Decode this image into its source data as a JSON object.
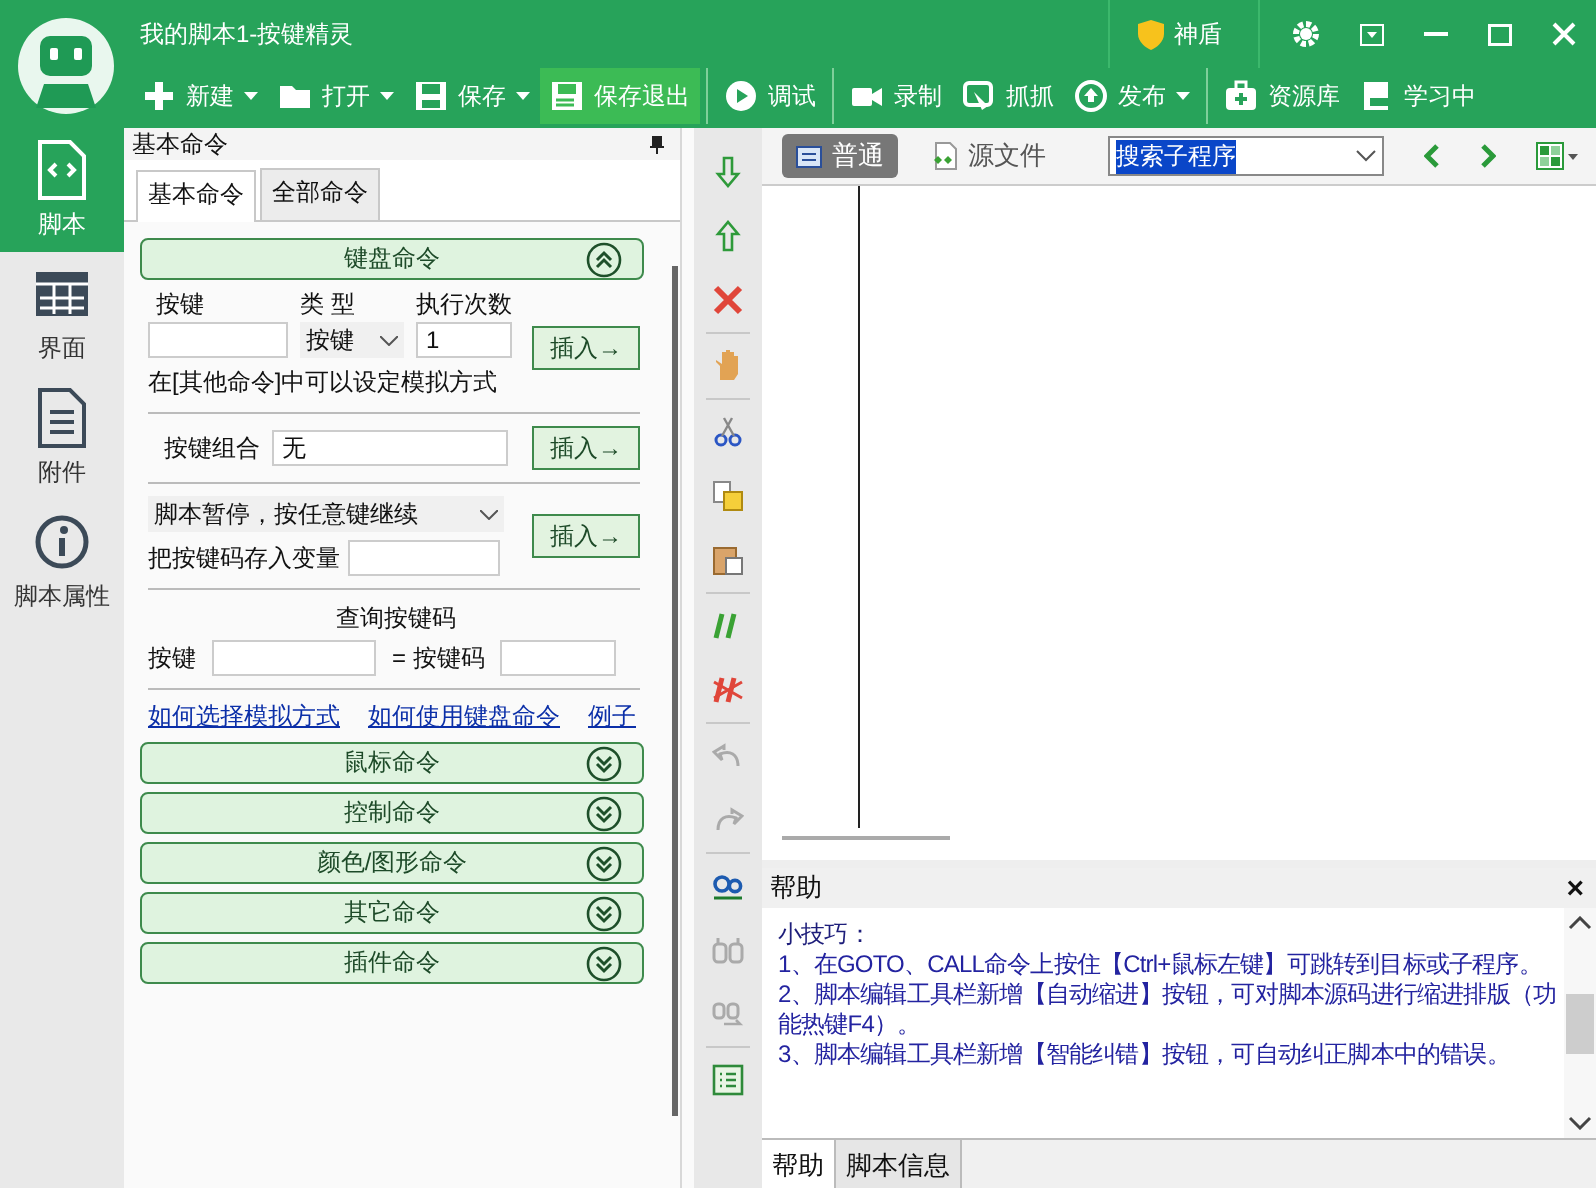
{
  "window": {
    "title": "我的脚本1-按键精灵"
  },
  "title_bar": {
    "shield": "神盾"
  },
  "toolbar": [
    {
      "label": "新建",
      "dropdown": true,
      "highlighted": false,
      "separator_before": false
    },
    {
      "label": "打开",
      "dropdown": true,
      "highlighted": false,
      "separator_before": false
    },
    {
      "label": "保存",
      "dropdown": true,
      "highlighted": false,
      "separator_before": false
    },
    {
      "label": "保存退出",
      "dropdown": false,
      "highlighted": true,
      "separator_before": false
    },
    {
      "label": "调试",
      "dropdown": false,
      "highlighted": false,
      "separator_before": true
    },
    {
      "label": "录制",
      "dropdown": false,
      "highlighted": false,
      "separator_before": true
    },
    {
      "label": "抓抓",
      "dropdown": false,
      "highlighted": false,
      "separator_before": false
    },
    {
      "label": "发布",
      "dropdown": true,
      "highlighted": false,
      "separator_before": false
    },
    {
      "label": "资源库",
      "dropdown": false,
      "highlighted": false,
      "separator_before": true
    },
    {
      "label": "学习中",
      "dropdown": false,
      "highlighted": false,
      "separator_before": false
    }
  ],
  "sidebar": {
    "items": [
      {
        "label": "脚本",
        "selected": true
      },
      {
        "label": "界面",
        "selected": false
      },
      {
        "label": "附件",
        "selected": false
      },
      {
        "label": "脚本属性",
        "selected": false
      }
    ]
  },
  "panel": {
    "title": "基本命令",
    "tabs": [
      {
        "label": "基本命令",
        "selected": true
      },
      {
        "label": "全部命令",
        "selected": false
      }
    ],
    "sections": [
      {
        "title": "键盘命令",
        "expanded": true
      },
      {
        "title": "鼠标命令",
        "expanded": false
      },
      {
        "title": "控制命令",
        "expanded": false
      },
      {
        "title": "颜色/图形命令",
        "expanded": false
      },
      {
        "title": "其它命令",
        "expanded": false
      },
      {
        "title": "插件命令",
        "expanded": false
      }
    ],
    "keyboard": {
      "key_label": "按键",
      "type_label": "类 型",
      "count_label": "执行次数",
      "type_value": "按键",
      "count_value": "1",
      "insert": "插入→",
      "note": "在[其他命令]中可以设定模拟方式",
      "combo_label": "按键组合",
      "combo_value": "无",
      "combo_insert": "插入→",
      "pause_value": "脚本暂停，按任意键继续",
      "store_label": "把按键码存入变量",
      "pause_insert": "插入→",
      "query_title": "查询按键码",
      "query_key_label": "按键",
      "query_code_label": "= 按键码",
      "links": [
        "如何选择模拟方式",
        "如何使用键盘命令",
        "例子"
      ]
    }
  },
  "editor": {
    "view_tabs": [
      {
        "label": "普通",
        "selected": true
      },
      {
        "label": "源文件",
        "selected": false
      }
    ],
    "subroutine_search": "搜索子程序"
  },
  "help": {
    "title": "帮助",
    "close": "×",
    "heading": "小技巧：",
    "lines": [
      "1、在GOTO、CALL命令上按住【Ctrl+鼠标左键】可跳转到目标或子程序。",
      "2、脚本编辑工具栏新增【自动缩进】按钮，可对脚本源码进行缩进排版（功能热键F4）。",
      "3、脚本编辑工具栏新增【智能纠错】按钮，可自动纠正脚本中的错误。"
    ],
    "tabs": [
      {
        "label": "帮助",
        "selected": true
      },
      {
        "label": "脚本信息",
        "selected": false
      }
    ]
  }
}
